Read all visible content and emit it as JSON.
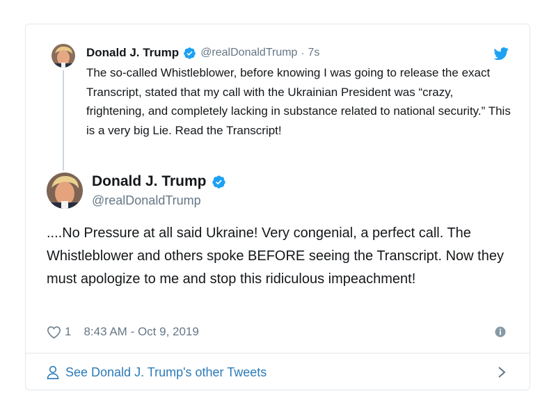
{
  "parent_tweet": {
    "name": "Donald J. Trump",
    "handle": "@realDonaldTrump",
    "separator": "·",
    "time": "7s",
    "text": "The so-called Whistleblower, before knowing I was going to release the exact Transcript, stated that my call with the Ukrainian President was “crazy, frightening, and completely lacking in substance related to national security.” This is a very big Lie. Read the Transcript!"
  },
  "main_tweet": {
    "name": "Donald J. Trump",
    "handle": "@realDonaldTrump",
    "text": "....No Pressure at all said Ukraine! Very congenial, a perfect call. The Whistleblower and others spoke BEFORE seeing the Transcript. Now they must apologize to me and stop this ridiculous impeachment!",
    "like_count": "1",
    "timestamp": "8:43 AM - Oct 9, 2019"
  },
  "footer": {
    "label": "See Donald J. Trump's other Tweets"
  },
  "icons": {
    "verified": "verified-badge-icon",
    "bird": "twitter-bird-icon",
    "heart": "heart-icon",
    "info": "info-icon",
    "person": "person-icon",
    "chevron": "chevron-right-icon"
  },
  "colors": {
    "brand_blue": "#1da1f2",
    "link_blue": "#2b7bb9",
    "secondary_text": "#657786",
    "border": "#e1e8ed"
  }
}
